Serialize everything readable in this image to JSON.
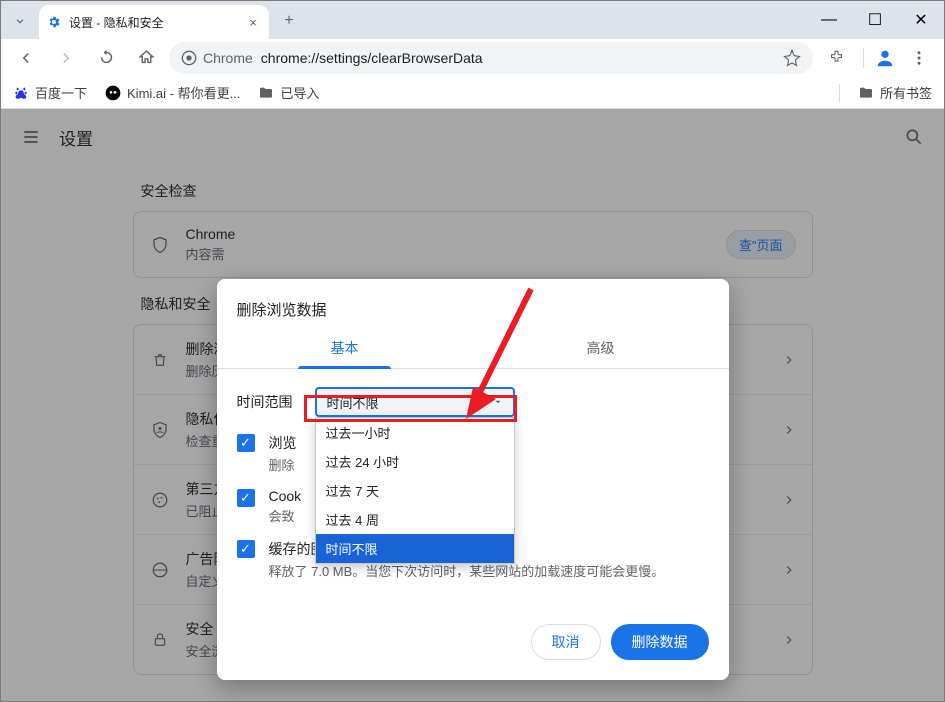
{
  "window": {
    "tab_title": "设置 - 隐私和安全",
    "new_tab_glyph": "+",
    "close_tab_glyph": "×",
    "win_min": "—",
    "win_max": "☐",
    "win_close": "✕"
  },
  "toolbar": {
    "omnibox_prefix": "Chrome",
    "url": "chrome://settings/clearBrowserData"
  },
  "bookmarks": {
    "baidu": "百度一下",
    "kimi": "Kimi.ai - 帮你看更...",
    "imported": "已导入",
    "all_folder": "所有书签"
  },
  "settings": {
    "menu_glyph": "≡",
    "title": "设置",
    "safety_check_section": "安全检查",
    "safety_check_title": "Chrome",
    "safety_check_sub": "内容需",
    "safety_check_chip": "查\"页面",
    "privacy_section": "隐私和安全",
    "rows": [
      {
        "t1": "删除浏",
        "t2": "删除历"
      },
      {
        "t1": "隐私保",
        "t2": "检查重"
      },
      {
        "t1": "第三方",
        "t2": "已阻止"
      },
      {
        "t1": "广告隐",
        "t2": "自定义"
      },
      {
        "t1": "安全",
        "t2": "安全浏览（保护您免受危险网站的侵害）和其他安全设置"
      }
    ]
  },
  "dialog": {
    "title": "删除浏览数据",
    "tab_basic": "基本",
    "tab_advanced": "高级",
    "time_label": "时间范围",
    "time_selected": "时间不限",
    "time_options": [
      "过去一小时",
      "过去 24 小时",
      "过去 7 天",
      "过去 4 周",
      "时间不限"
    ],
    "check1_t1": "浏览",
    "check1_t2": "删除",
    "check2_t1": "Cook",
    "check2_t2": "会致",
    "check3_t1": "缓存的图片和文件",
    "check3_t2": "释放了 7.0 MB。当您下次访问时，某些网站的加载速度可能会更慢。",
    "cancel": "取消",
    "confirm": "删除数据"
  }
}
